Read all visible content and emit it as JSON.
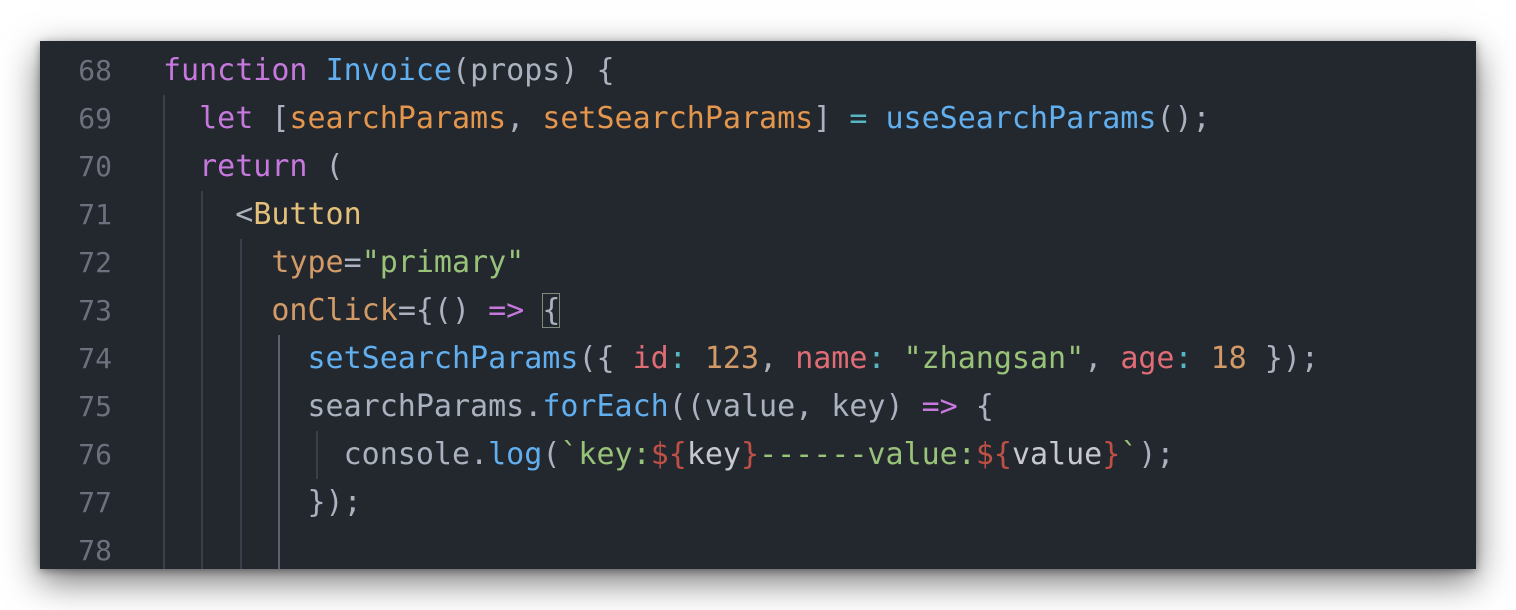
{
  "editor": {
    "top_fragment": "()",
    "lines": [
      {
        "number": "68",
        "tokens": [
          {
            "t": "function",
            "c": "kw"
          },
          {
            "t": " ",
            "c": "pr"
          },
          {
            "t": "Invoice",
            "c": "fn"
          },
          {
            "t": "(",
            "c": "pr"
          },
          {
            "t": "props",
            "c": "pr"
          },
          {
            "t": ") {",
            "c": "pr"
          }
        ]
      },
      {
        "number": "69",
        "tokens": [
          {
            "t": "  ",
            "c": "pr"
          },
          {
            "t": "let",
            "c": "kw"
          },
          {
            "t": " [",
            "c": "pr"
          },
          {
            "t": "searchParams",
            "c": "par"
          },
          {
            "t": ", ",
            "c": "pr"
          },
          {
            "t": "setSearchParams",
            "c": "par"
          },
          {
            "t": "] ",
            "c": "pr"
          },
          {
            "t": "=",
            "c": "op"
          },
          {
            "t": " ",
            "c": "pr"
          },
          {
            "t": "useSearchParams",
            "c": "fn"
          },
          {
            "t": "();",
            "c": "pr"
          }
        ]
      },
      {
        "number": "70",
        "tokens": [
          {
            "t": "  ",
            "c": "pr"
          },
          {
            "t": "return",
            "c": "kw"
          },
          {
            "t": " (",
            "c": "pr"
          }
        ]
      },
      {
        "number": "71",
        "tokens": [
          {
            "t": "    <",
            "c": "pr"
          },
          {
            "t": "Button",
            "c": "tag"
          }
        ]
      },
      {
        "number": "72",
        "tokens": [
          {
            "t": "      ",
            "c": "pr"
          },
          {
            "t": "type",
            "c": "attr"
          },
          {
            "t": "=",
            "c": "pr"
          },
          {
            "t": "\"primary\"",
            "c": "str"
          }
        ]
      },
      {
        "number": "73",
        "tokens": [
          {
            "t": "      ",
            "c": "pr"
          },
          {
            "t": "onClick",
            "c": "attr"
          },
          {
            "t": "={() ",
            "c": "pr"
          },
          {
            "t": "=>",
            "c": "kw"
          },
          {
            "t": " ",
            "c": "pr"
          },
          {
            "t": "{",
            "c": "pr",
            "box": true
          }
        ]
      },
      {
        "number": "74",
        "tokens": [
          {
            "t": "        ",
            "c": "pr"
          },
          {
            "t": "setSearchParams",
            "c": "fn"
          },
          {
            "t": "({ ",
            "c": "pr"
          },
          {
            "t": "id",
            "c": "key"
          },
          {
            "t": ":",
            "c": "op"
          },
          {
            "t": " ",
            "c": "pr"
          },
          {
            "t": "123",
            "c": "num"
          },
          {
            "t": ", ",
            "c": "pr"
          },
          {
            "t": "name",
            "c": "key"
          },
          {
            "t": ":",
            "c": "op"
          },
          {
            "t": " ",
            "c": "pr"
          },
          {
            "t": "\"zhangsan\"",
            "c": "str"
          },
          {
            "t": ", ",
            "c": "pr"
          },
          {
            "t": "age",
            "c": "key"
          },
          {
            "t": ":",
            "c": "op"
          },
          {
            "t": " ",
            "c": "pr"
          },
          {
            "t": "18",
            "c": "num"
          },
          {
            "t": " });",
            "c": "pr"
          }
        ]
      },
      {
        "number": "75",
        "tokens": [
          {
            "t": "        ",
            "c": "pr"
          },
          {
            "t": "searchParams",
            "c": "pr"
          },
          {
            "t": ".",
            "c": "pr"
          },
          {
            "t": "forEach",
            "c": "fn"
          },
          {
            "t": "((value, key) ",
            "c": "pr"
          },
          {
            "t": "=>",
            "c": "kw"
          },
          {
            "t": " {",
            "c": "pr"
          }
        ]
      },
      {
        "number": "76",
        "tokens": [
          {
            "t": "          ",
            "c": "pr"
          },
          {
            "t": "console",
            "c": "pr"
          },
          {
            "t": ".",
            "c": "pr"
          },
          {
            "t": "log",
            "c": "fn"
          },
          {
            "t": "(",
            "c": "pr"
          },
          {
            "t": "`key:",
            "c": "str"
          },
          {
            "t": "${",
            "c": "tpl"
          },
          {
            "t": "key",
            "c": "tplvar"
          },
          {
            "t": "}",
            "c": "tpl"
          },
          {
            "t": "------value:",
            "c": "str"
          },
          {
            "t": "${",
            "c": "tpl"
          },
          {
            "t": "value",
            "c": "tplvar"
          },
          {
            "t": "}",
            "c": "tpl"
          },
          {
            "t": "`",
            "c": "str"
          },
          {
            "t": ");",
            "c": "pr"
          }
        ]
      },
      {
        "number": "77",
        "tokens": [
          {
            "t": "        ",
            "c": "pr"
          },
          {
            "t": "});",
            "c": "pr"
          }
        ]
      },
      {
        "number": "78",
        "tokens": []
      }
    ]
  }
}
